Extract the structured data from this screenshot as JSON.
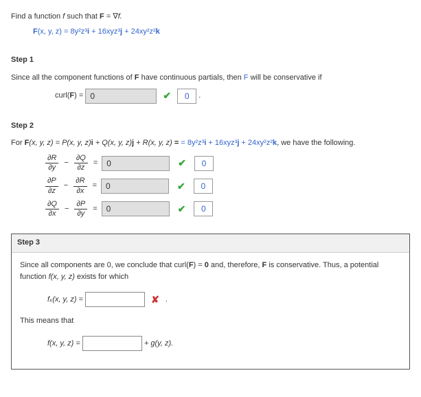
{
  "intro": {
    "line1_a": "Find a function ",
    "line1_f": "f",
    "line1_b": " such that ",
    "line1_c": "F",
    "line1_d": " = ∇",
    "line1_e": "f.",
    "eq_lhs": "F",
    "eq_args": "(x, y, z) = ",
    "term1": "8y²z³",
    "i": "i",
    "plus1": " + ",
    "term2": "16xyz³",
    "j": "j",
    "plus2": " + ",
    "term3": "24xy²z²",
    "k": "k"
  },
  "step1": {
    "header": "Step 1",
    "text_a": "Since all the component functions of ",
    "text_b": "F",
    "text_c": " have continuous partials, then ",
    "text_d": "F",
    "text_e": " will be conservative if",
    "curl_label": "curl(",
    "curl_F": "F",
    "curl_close": ") = ",
    "input_val": "0",
    "answer_val": "0"
  },
  "step2": {
    "header": "Step 2",
    "text_a": "For  ",
    "text_F": "F",
    "text_args": "(x, y, z) = P(x, y, z)",
    "text_i": "i",
    "text_b": " + Q(x, y, z)",
    "text_j": "j",
    "text_c": " + R(x, y, z)",
    "text_k": "k",
    "text_d": " = ",
    "t1": "8y²z³",
    "t1s": "i",
    "p1": " + ",
    "t2": "16xyz³",
    "t2s": "j",
    "p2": " + ",
    "t3": "24xy²z²",
    "t3s": "k",
    "text_e": ",  we have the following.",
    "rows": [
      {
        "l_top": "∂R",
        "l_bot": "∂y",
        "r_top": "∂Q",
        "r_bot": "∂z",
        "val": "0",
        "ans": "0"
      },
      {
        "l_top": "∂P",
        "l_bot": "∂z",
        "r_top": "∂R",
        "r_bot": "∂x",
        "val": "0",
        "ans": "0"
      },
      {
        "l_top": "∂Q",
        "l_bot": "∂x",
        "r_top": "∂P",
        "r_bot": "∂y",
        "val": "0",
        "ans": "0"
      }
    ]
  },
  "step3": {
    "header": "Step 3",
    "para_a": "Since all components are 0, we conclude that curl(",
    "para_F": "F",
    "para_b": ") = ",
    "para_zero": "0",
    "para_c": " and, therefore, ",
    "para_F2": "F",
    "para_d": " is conservative. Thus, a potential function ",
    "para_f": "f(x, y, z)",
    "para_e": " exists for which",
    "fx_label": "fₓ(x, y, z) = ",
    "this_means": "This means that",
    "f_label": "f(x, y, z) = ",
    "rhs": " + g(y, z)."
  }
}
